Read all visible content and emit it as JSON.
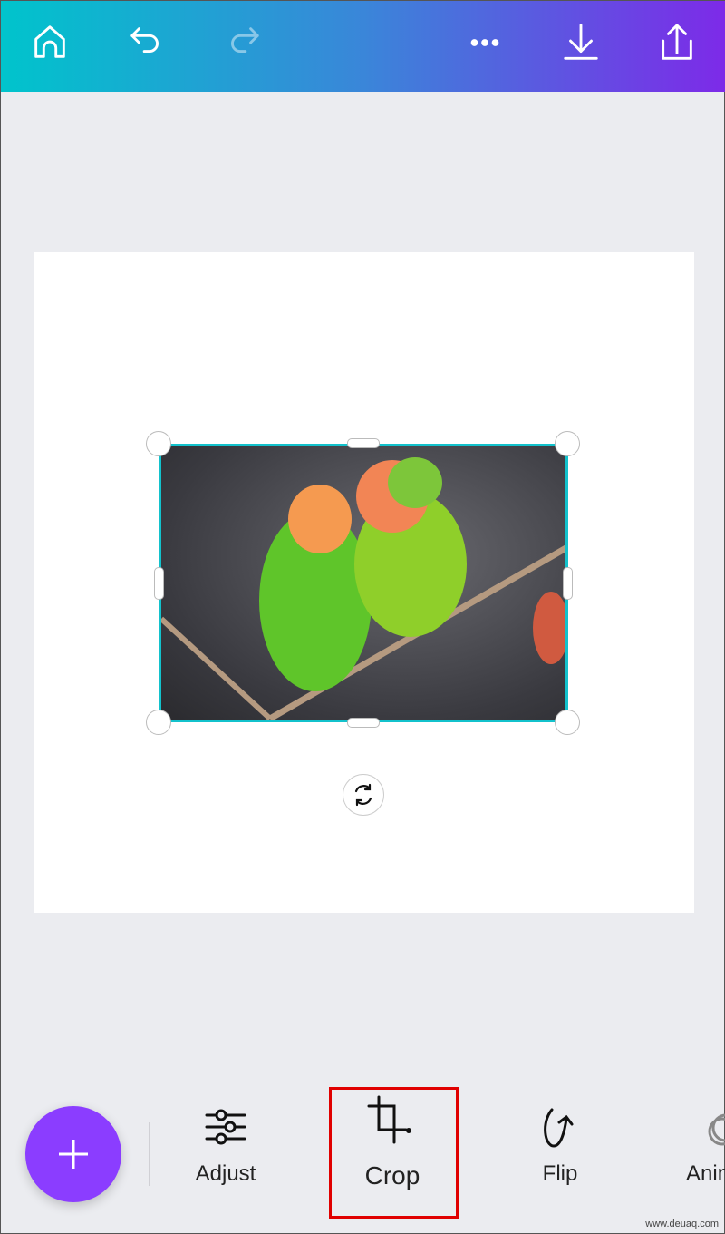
{
  "topbar": {
    "icons": [
      "home-icon",
      "undo-icon",
      "redo-icon",
      "more-icon",
      "download-icon",
      "share-icon"
    ],
    "gradient": [
      "#00c4cc",
      "#7d2ae8"
    ]
  },
  "canvas": {
    "image": "two lovebirds on branch",
    "selection_color": "#13c2cc"
  },
  "toolbar": {
    "add_icon": "plus-icon",
    "fab_color": "#8b3dff",
    "tools": [
      {
        "label": "Adjust",
        "icon": "sliders-icon"
      },
      {
        "label": "Crop",
        "icon": "crop-icon",
        "highlighted": true
      },
      {
        "label": "Flip",
        "icon": "flip-icon"
      },
      {
        "label": "Anim",
        "icon": "animate-icon"
      }
    ]
  },
  "watermark": "www.deuaq.com"
}
